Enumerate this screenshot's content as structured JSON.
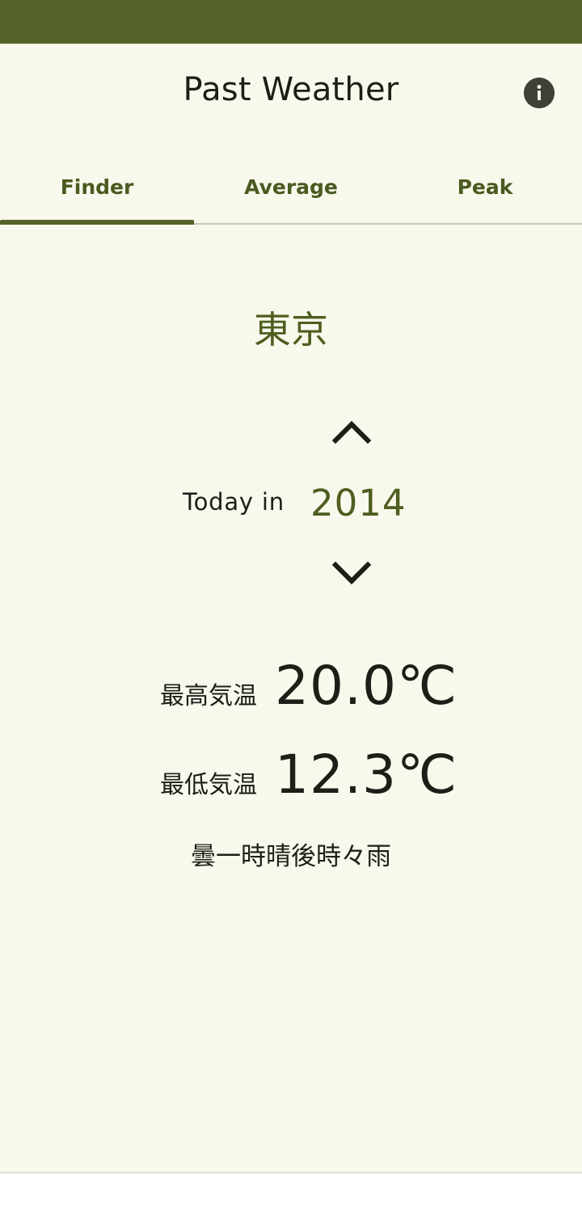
{
  "app": {
    "title": "Past Weather",
    "info_icon": "info-icon"
  },
  "tabs": [
    {
      "label": "Finder",
      "active": true
    },
    {
      "label": "Average",
      "active": false
    },
    {
      "label": "Peak",
      "active": false
    }
  ],
  "finder": {
    "location": "東京",
    "today_label": "Today in",
    "year": "2014",
    "year_up_icon": "chevron-up-icon",
    "year_down_icon": "chevron-down-icon",
    "high_label": "最高気温",
    "high_value": "20.0℃",
    "low_label": "最低気温",
    "low_value": "12.3℃",
    "description": "曇一時晴後時々雨"
  },
  "colors": {
    "status_bar": "#546428",
    "accent": "#546428",
    "accent_text": "#4d5e1f",
    "background": "#f8f8ec"
  }
}
